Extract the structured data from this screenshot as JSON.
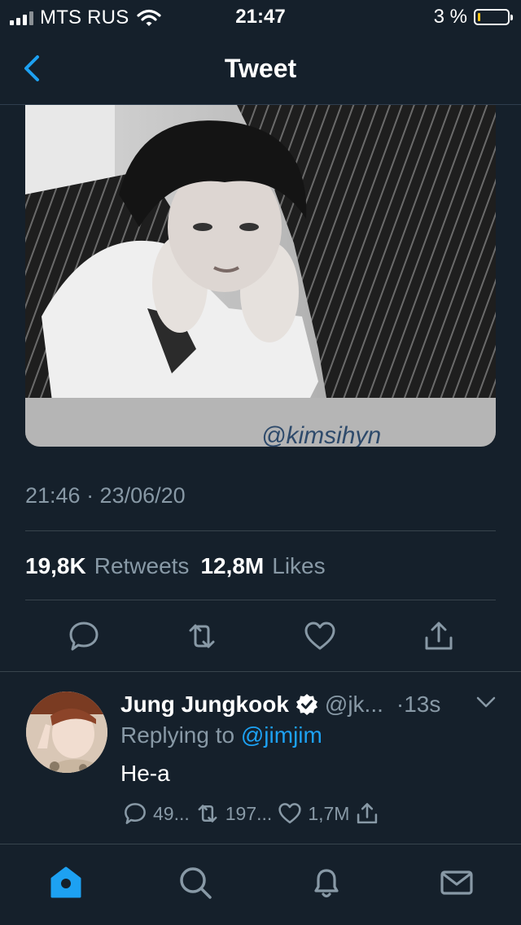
{
  "status_bar": {
    "carrier": "MTS RUS",
    "time": "21:47",
    "battery": "3 %"
  },
  "header": {
    "title": "Tweet"
  },
  "tweet": {
    "timestamp": "21:46 · 23/06/20",
    "retweets_count": "19,8K",
    "retweets_label": "Retweets",
    "likes_count": "12,8M",
    "likes_label": "Likes",
    "image_watermark": "@kimsihyn"
  },
  "reply": {
    "name": "Jung Jungkook",
    "handle": "@jk...",
    "time": "·13s",
    "replying_prefix": "Replying to",
    "replying_to": "@jimjim",
    "text": "He-a",
    "comments": "49...",
    "retweets": "197...",
    "likes": "1,7M"
  },
  "colors": {
    "background": "#15202b",
    "accent": "#1da1f2",
    "muted": "#8899a6"
  }
}
